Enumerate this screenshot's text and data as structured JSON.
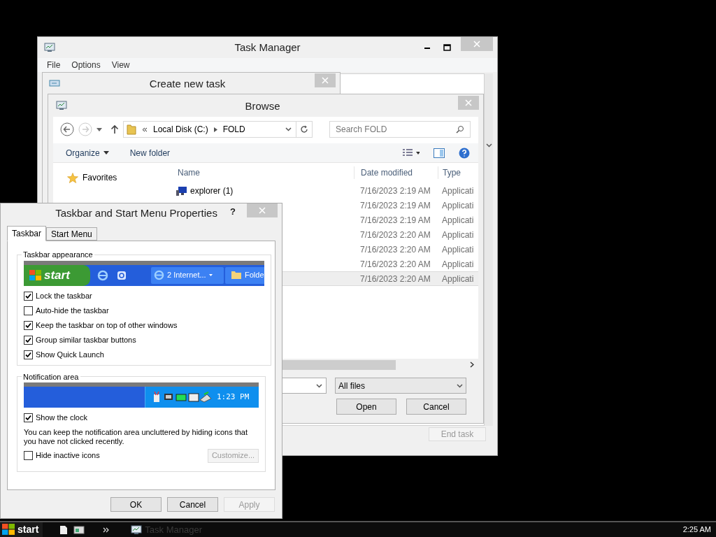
{
  "task_manager": {
    "title": "Task Manager",
    "menu": [
      "File",
      "Options",
      "View"
    ],
    "end_task": {
      "label": "End task",
      "disabled": true
    }
  },
  "create_new_task": {
    "title": "Create new task"
  },
  "browse": {
    "title": "Browse",
    "path": [
      "Local Disk (C:)",
      "FOLD"
    ],
    "search": {
      "placeholder": "Search FOLD"
    },
    "toolbar": [
      "Organize",
      "New folder"
    ],
    "nav": [
      "Favorites"
    ],
    "columns": [
      "Name",
      "Date modified",
      "Type"
    ],
    "rows": [
      {
        "name": "explorer (1)",
        "date": "7/16/2023 2:19 AM",
        "type": "Applicati",
        "selected": false
      },
      {
        "date": "7/16/2023 2:19 AM",
        "type": "Applicati",
        "selected": false
      },
      {
        "date": "7/16/2023 2:19 AM",
        "type": "Applicati",
        "selected": false
      },
      {
        "date": "7/16/2023 2:20 AM",
        "type": "Applicati",
        "selected": false
      },
      {
        "date": "7/16/2023 2:20 AM",
        "type": "Applicati",
        "selected": false
      },
      {
        "date": "7/16/2023 2:20 AM",
        "type": "Applicati",
        "selected": false
      },
      {
        "date": "7/16/2023 2:20 AM",
        "type": "Applicati",
        "selected": true
      }
    ],
    "filter": "All files",
    "buttons": [
      "Open",
      "Cancel"
    ]
  },
  "taskbar_properties": {
    "title": "Taskbar and Start Menu Properties",
    "help": "?",
    "tabs": [
      {
        "label": "Taskbar",
        "selected": true
      },
      {
        "label": "Start Menu",
        "selected": false
      }
    ],
    "appearance": {
      "legend": "Taskbar appearance",
      "preview": {
        "start": "start",
        "task": "2 Internet...",
        "folder": "Folde"
      },
      "options": [
        {
          "label": "Lock the taskbar",
          "checked": true
        },
        {
          "label": "Auto-hide the taskbar",
          "checked": false
        },
        {
          "label": "Keep the taskbar on top of other windows",
          "checked": true
        },
        {
          "label": "Group similar taskbar buttons",
          "checked": true
        },
        {
          "label": "Show Quick Launch",
          "checked": true
        }
      ]
    },
    "notification": {
      "legend": "Notification area",
      "preview_clock": "1:23 PM",
      "show_clock": {
        "label": "Show the clock",
        "checked": true
      },
      "note": "You can keep the notification area uncluttered by hiding icons that you have not clicked recently.",
      "hide_inactive": {
        "label": "Hide inactive icons",
        "checked": false
      },
      "customize": {
        "label": "Customize...",
        "disabled": true
      }
    },
    "buttons": [
      {
        "label": "OK",
        "disabled": false
      },
      {
        "label": "Cancel",
        "disabled": false
      },
      {
        "label": "Apply",
        "disabled": true
      }
    ]
  },
  "desktop_taskbar": {
    "start": "start",
    "tasks": [
      "Task Manager"
    ],
    "clock": "2:25 AM"
  }
}
